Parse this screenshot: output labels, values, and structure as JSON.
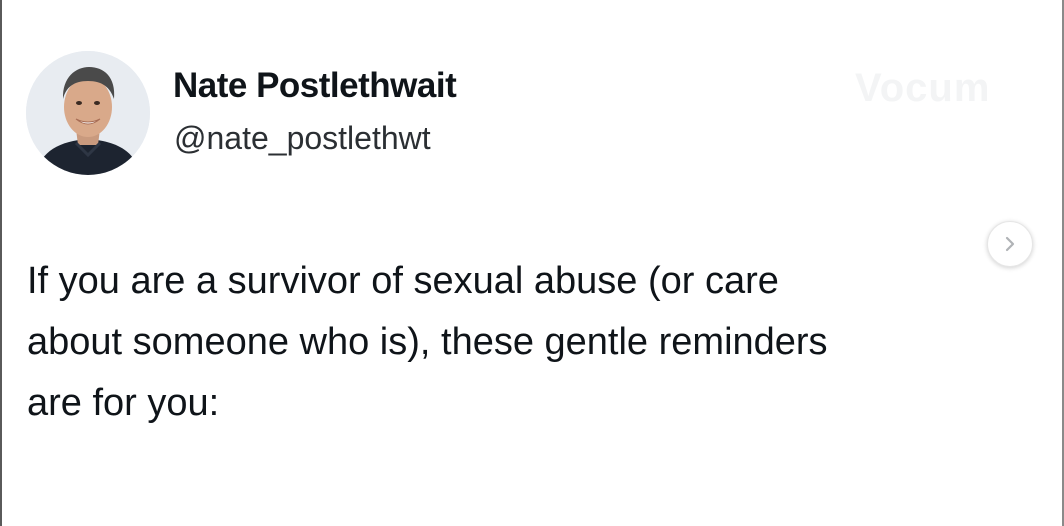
{
  "tweet": {
    "author": {
      "name": "Nate Postlethwait",
      "handle": "@nate_postlethwt"
    },
    "watermark": "Vocum",
    "text_lines": [
      "If you are a survivor of sexual abuse (or care",
      "about someone who is), these gentle reminders",
      "are for you:"
    ]
  },
  "controls": {
    "next_icon": "chevron-right-icon"
  },
  "colors": {
    "text": "#0f1419",
    "handle": "#2b2f33",
    "background": "#ffffff"
  }
}
